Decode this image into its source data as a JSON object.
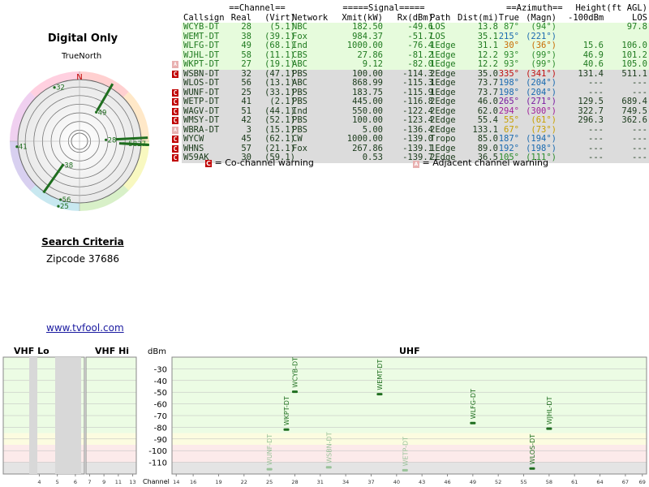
{
  "page": {
    "title": "Digital Only",
    "true_north_label": "TrueNorth",
    "north_letter": "N",
    "search_title": "Search Criteria",
    "zipcode_line": "Zipcode 37686",
    "link_text": "www.tvfool.com"
  },
  "table": {
    "group_headers": {
      "channel": "==Channel==",
      "signal": "=====Signal=====",
      "azimuth": "==Azimuth==",
      "height": "Height(ft AGL)"
    },
    "columns": {
      "callsign": "Callsign",
      "real": "Real",
      "virt": "(Virt)",
      "network": "Network",
      "xmit": "Xmit(kW)",
      "rx": "Rx(dBm)",
      "path": "Path",
      "dist": "Dist(mi)",
      "true": "True",
      "magn": "(Magn)",
      "h100": "-100dBm",
      "los": "LOS"
    },
    "rows": [
      {
        "callsign": "WCYB-DT",
        "real": "28",
        "virt": "(5.1)",
        "network": "NBC",
        "xmit": "182.50",
        "rx": "-49.6",
        "path": "LOS",
        "dist": "13.8",
        "true": "87°",
        "magn": "(94°)",
        "h100": "",
        "los": "97.8",
        "flag": "",
        "band": "green",
        "az_color": "#2a8a2a"
      },
      {
        "callsign": "WEMT-DT",
        "real": "38",
        "virt": "(39.1)",
        "network": "Fox",
        "xmit": "984.37",
        "rx": "-51.7",
        "path": "LOS",
        "dist": "35.1",
        "true": "215°",
        "magn": "(221°)",
        "h100": "",
        "los": "",
        "flag": "",
        "band": "green",
        "az_color": "#1a6ab0"
      },
      {
        "callsign": "WLFG-DT",
        "real": "49",
        "virt": "(68.1)",
        "network": "Ind",
        "xmit": "1000.00",
        "rx": "-76.4",
        "path": "1Edge",
        "dist": "31.1",
        "true": "30°",
        "magn": "(36°)",
        "h100": "15.6",
        "los": "106.0",
        "flag": "",
        "band": "green",
        "az_color": "#c86b00"
      },
      {
        "callsign": "WJHL-DT",
        "real": "58",
        "virt": "(11.1)",
        "network": "CBS",
        "xmit": "27.86",
        "rx": "-81.2",
        "path": "1Edge",
        "dist": "12.2",
        "true": "93°",
        "magn": "(99°)",
        "h100": "46.9",
        "los": "101.2",
        "flag": "",
        "band": "green",
        "az_color": "#2a8a2a"
      },
      {
        "callsign": "WKPT-DT",
        "real": "27",
        "virt": "(19.1)",
        "network": "ABC",
        "xmit": "9.12",
        "rx": "-82.0",
        "path": "1Edge",
        "dist": "12.2",
        "true": "93°",
        "magn": "(99°)",
        "h100": "40.6",
        "los": "105.0",
        "flag": "adj",
        "band": "green",
        "az_color": "#2a8a2a"
      },
      {
        "callsign": "WSBN-DT",
        "real": "32",
        "virt": "(47.1)",
        "network": "PBS",
        "xmit": "100.00",
        "rx": "-114.3",
        "path": "2Edge",
        "dist": "35.0",
        "true": "335°",
        "magn": "(341°)",
        "h100": "131.4",
        "los": "511.1",
        "flag": "co",
        "band": "gray",
        "az_color": "#c01010"
      },
      {
        "callsign": "WLOS-DT",
        "real": "56",
        "virt": "(13.1)",
        "network": "ABC",
        "xmit": "868.99",
        "rx": "-115.3",
        "path": "1Edge",
        "dist": "73.7",
        "true": "198°",
        "magn": "(204°)",
        "h100": "---",
        "los": "---",
        "flag": "",
        "band": "gray",
        "az_color": "#1a6ab0"
      },
      {
        "callsign": "WUNF-DT",
        "real": "25",
        "virt": "(33.1)",
        "network": "PBS",
        "xmit": "183.75",
        "rx": "-115.9",
        "path": "1Edge",
        "dist": "73.7",
        "true": "198°",
        "magn": "(204°)",
        "h100": "---",
        "los": "---",
        "flag": "co",
        "band": "gray",
        "az_color": "#1a6ab0"
      },
      {
        "callsign": "WETP-DT",
        "real": "41",
        "virt": "(2.1)",
        "network": "PBS",
        "xmit": "445.00",
        "rx": "-116.8",
        "path": "2Edge",
        "dist": "46.0",
        "true": "265°",
        "magn": "(271°)",
        "h100": "129.5",
        "los": "689.4",
        "flag": "co",
        "band": "gray",
        "az_color": "#7a1aa0"
      },
      {
        "callsign": "WAGV-DT",
        "real": "51",
        "virt": "(44.1)",
        "network": "Ind",
        "xmit": "550.00",
        "rx": "-122.4",
        "path": "2Edge",
        "dist": "62.0",
        "true": "294°",
        "magn": "(300°)",
        "h100": "322.7",
        "los": "749.5",
        "flag": "co",
        "band": "gray",
        "az_color": "#a0209a"
      },
      {
        "callsign": "WMSY-DT",
        "real": "42",
        "virt": "(52.1)",
        "network": "PBS",
        "xmit": "100.00",
        "rx": "-123.4",
        "path": "2Edge",
        "dist": "55.4",
        "true": "55°",
        "magn": "(61°)",
        "h100": "296.3",
        "los": "362.6",
        "flag": "co",
        "band": "gray",
        "az_color": "#c8a000"
      },
      {
        "callsign": "WBRA-DT",
        "real": "3",
        "virt": "(15.1)",
        "network": "PBS",
        "xmit": "5.00",
        "rx": "-136.4",
        "path": "2Edge",
        "dist": "133.1",
        "true": "67°",
        "magn": "(73°)",
        "h100": "---",
        "los": "---",
        "flag": "adj",
        "band": "gray",
        "az_color": "#c8a000"
      },
      {
        "callsign": "WYCW",
        "real": "45",
        "virt": "(62.1)",
        "network": "CW",
        "xmit": "1000.00",
        "rx": "-139.0",
        "path": "Tropo",
        "dist": "85.0",
        "true": "187°",
        "magn": "(194°)",
        "h100": "---",
        "los": "---",
        "flag": "co",
        "band": "gray",
        "az_color": "#1a6ab0"
      },
      {
        "callsign": "WHNS",
        "real": "57",
        "virt": "(21.1)",
        "network": "Fox",
        "xmit": "267.86",
        "rx": "-139.1",
        "path": "1Edge",
        "dist": "89.0",
        "true": "192°",
        "magn": "(198°)",
        "h100": "---",
        "los": "---",
        "flag": "co",
        "band": "gray",
        "az_color": "#1a6ab0"
      },
      {
        "callsign": "W59AK",
        "real": "30",
        "virt": "(59.1)",
        "network": "",
        "xmit": "0.53",
        "rx": "-139.7",
        "path": "2Edge",
        "dist": "36.5",
        "true": "105°",
        "magn": "(111°)",
        "h100": "---",
        "los": "---",
        "flag": "co",
        "band": "gray",
        "az_color": "#2a8a2a"
      }
    ],
    "flag_glyph_co": "C",
    "flag_glyph_adj": "A"
  },
  "legend": {
    "co_text": "= Co-channel warning",
    "adj_text": "= Adjacent channel warning"
  },
  "polar": {
    "labels": [
      {
        "text": "32",
        "az": 335,
        "r": 0.85
      },
      {
        "text": "49",
        "az": 30,
        "r": 0.48
      },
      {
        "text": "28",
        "az": 87,
        "r": 0.38
      },
      {
        "text": "5827",
        "az": 93,
        "r": 0.68
      },
      {
        "text": "41",
        "az": 265,
        "r": 0.9
      },
      {
        "text": "38",
        "az": 215,
        "r": 0.42
      },
      {
        "text": "56",
        "az": 198,
        "r": 0.88
      },
      {
        "text": "25",
        "az": 198,
        "r": 0.98
      }
    ],
    "spokes": [
      {
        "az": 87,
        "r0": 0.52,
        "r1": 0.98
      },
      {
        "az": 93,
        "r0": 0.57,
        "r1": 1.0
      },
      {
        "az": 30,
        "r0": 0.5,
        "r1": 0.95
      },
      {
        "az": 215,
        "r0": 0.4,
        "r1": 0.9
      },
      {
        "az": 93,
        "r0": 0.62,
        "r1": 0.98
      }
    ]
  },
  "chart_data": {
    "type": "bar",
    "title": "",
    "bands": {
      "vhf_lo": "VHF Lo",
      "vhf_hi": "VHF Hi",
      "uhf": "UHF"
    },
    "ylabel": "dBm",
    "xlabel": "Channel",
    "ylim": [
      -120,
      -20
    ],
    "yticks": [
      -30,
      -40,
      -50,
      -60,
      -70,
      -80,
      -90,
      -100,
      -110
    ],
    "vhf_lo_ticks": [
      4,
      5,
      6
    ],
    "vhf_hi_ticks": [
      7,
      9,
      11,
      13
    ],
    "uhf_ticks": [
      14,
      16,
      19,
      22,
      25,
      28,
      31,
      34,
      37,
      40,
      43,
      46,
      49,
      52,
      55,
      58,
      61,
      64,
      67,
      69
    ],
    "stations": [
      {
        "callsign": "WUNF-DT",
        "channel": 25,
        "value": -115.9,
        "color": "#99c299"
      },
      {
        "callsign": "WKPT-DT",
        "channel": 27,
        "value": -82.0,
        "color": "#1f6e1f"
      },
      {
        "callsign": "WCYB-DT",
        "channel": 28,
        "value": -49.6,
        "color": "#1f6e1f"
      },
      {
        "callsign": "WSBN-DT",
        "channel": 32,
        "value": -114.3,
        "color": "#99c299"
      },
      {
        "callsign": "WEMT-DT",
        "channel": 38,
        "value": -51.7,
        "color": "#1f6e1f"
      },
      {
        "callsign": "WETP-DT",
        "channel": 41,
        "value": -116.8,
        "color": "#99c299"
      },
      {
        "callsign": "WLFG-DT",
        "channel": 49,
        "value": -76.4,
        "color": "#1f6e1f"
      },
      {
        "callsign": "WLOS-DT",
        "channel": 56,
        "value": -115.3,
        "color": "#1f6e1f"
      },
      {
        "callsign": "WJHL-DT",
        "channel": 58,
        "value": -81.2,
        "color": "#1f6e1f"
      }
    ],
    "zones": {
      "green_to": -85,
      "yellow_to": -95,
      "pink_to": -110
    },
    "zone_colors": {
      "green": "#ecfce4",
      "yellow": "#fcfce0",
      "pink": "#fceaea",
      "gray": "#e4e4e4"
    }
  }
}
